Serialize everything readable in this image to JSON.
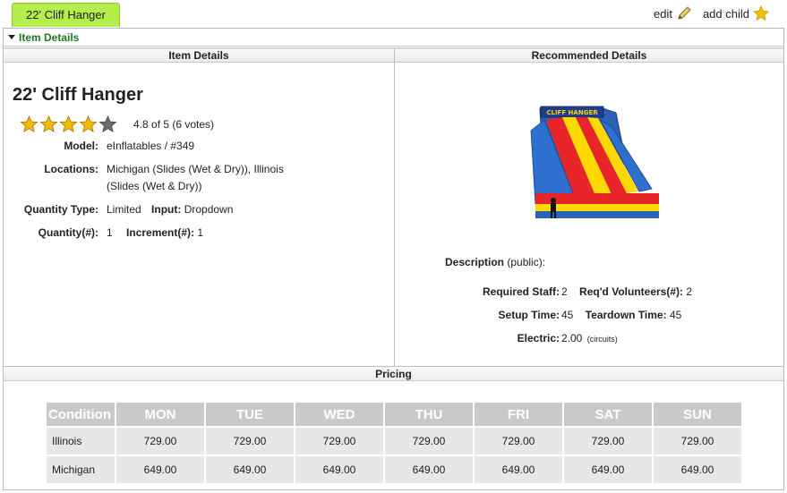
{
  "tab": {
    "label": "22' Cliff Hanger"
  },
  "actions": {
    "edit": "edit",
    "add_child": "add child"
  },
  "section": {
    "toggle_label": "Item Details"
  },
  "columns": {
    "left": "Item Details",
    "right": "Recommended Details"
  },
  "item": {
    "title": "22' Cliff Hanger",
    "rating_text": "4.8 of 5 (6 votes)",
    "rating_value": 4.8,
    "rating_max": 5,
    "model_label": "Model:",
    "model_value": "eInflatables / #349",
    "locations_label": "Locations:",
    "locations_line1": "Michigan (Slides (Wet & Dry)), Illinois",
    "locations_line2": "(Slides (Wet & Dry))",
    "qty_type_label": "Quantity Type:",
    "qty_type_value": "Limited",
    "input_label": "Input:",
    "input_value": "Dropdown",
    "qty_label": "Quantity(#):",
    "qty_value": "1",
    "increment_label": "Increment(#):",
    "increment_value": "1"
  },
  "recommended": {
    "description_label": "Description",
    "description_scope": "(public):",
    "staff_label": "Required Staff:",
    "staff_value": "2",
    "volunteers_label": "Req'd Volunteers(#):",
    "volunteers_value": "2",
    "setup_label": "Setup Time:",
    "setup_value": "45",
    "teardown_label": "Teardown Time:",
    "teardown_value": "45",
    "electric_label": "Electric:",
    "electric_value": "2.00",
    "electric_unit": "(circuits)",
    "image_banner": "CLIFF HANGER"
  },
  "pricing": {
    "title": "Pricing",
    "condition_header": "Condition",
    "days": [
      "MON",
      "TUE",
      "WED",
      "THU",
      "FRI",
      "SAT",
      "SUN"
    ],
    "rows": [
      {
        "condition": "Illinois",
        "prices": [
          "729.00",
          "729.00",
          "729.00",
          "729.00",
          "729.00",
          "729.00",
          "729.00"
        ]
      },
      {
        "condition": "Michigan",
        "prices": [
          "649.00",
          "649.00",
          "649.00",
          "649.00",
          "649.00",
          "649.00",
          "649.00"
        ]
      }
    ]
  },
  "colors": {
    "tab_bg": "#b2ee4c",
    "section_green": "#1f7a1f",
    "star": "#f5b800",
    "table_header": "#c9c9c9",
    "table_cell": "#e7e7e7"
  }
}
